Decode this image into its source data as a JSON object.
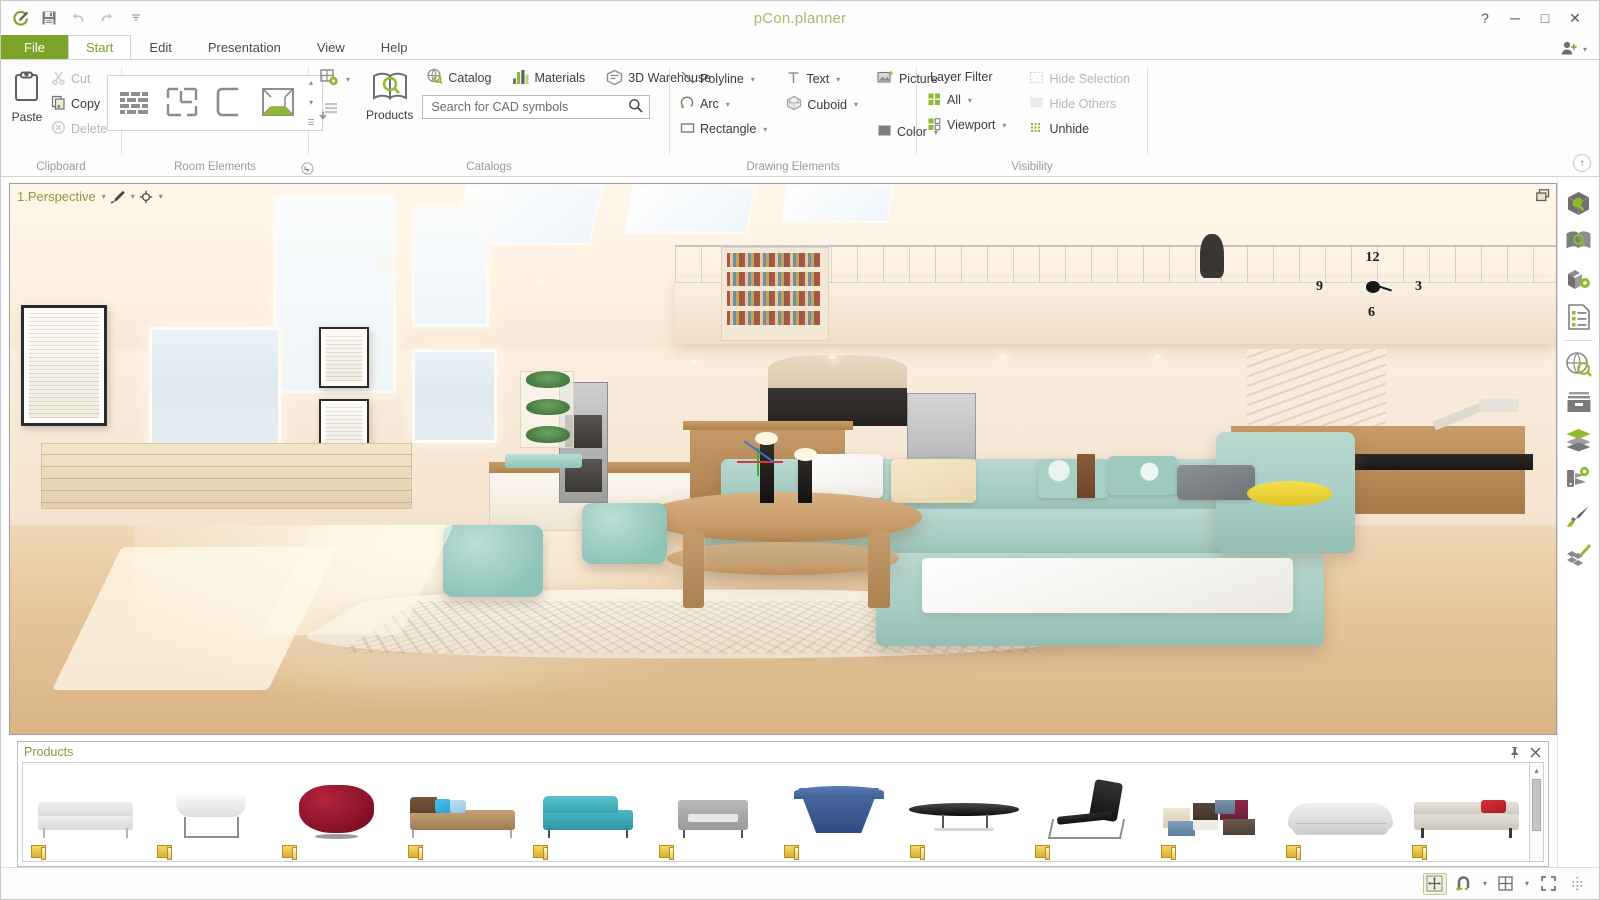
{
  "window": {
    "title": "pCon.planner",
    "help_label": "?",
    "minimize_label": "─",
    "maximize_label": "□",
    "close_label": "✕"
  },
  "quick_access": [
    {
      "name": "app-logo-icon",
      "label": "pCon logo"
    },
    {
      "name": "save-icon",
      "label": "Save"
    },
    {
      "name": "undo-icon",
      "label": "Undo"
    },
    {
      "name": "redo-icon",
      "label": "Redo"
    },
    {
      "name": "customize-qat-icon",
      "label": "Customize Quick Access Toolbar"
    }
  ],
  "tabs": [
    {
      "label": "File",
      "kind": "file"
    },
    {
      "label": "Start",
      "kind": "active"
    },
    {
      "label": "Edit",
      "kind": "normal"
    },
    {
      "label": "Presentation",
      "kind": "normal"
    },
    {
      "label": "View",
      "kind": "normal"
    },
    {
      "label": "Help",
      "kind": "normal"
    }
  ],
  "account": {
    "name": "account-icon",
    "caret": "▾"
  },
  "ribbon": {
    "collapse_label": "↑",
    "groups": {
      "clipboard": {
        "label": "Clipboard",
        "paste": "Paste",
        "cut": "Cut",
        "copy": "Copy",
        "delete": "Delete"
      },
      "room_elements": {
        "label": "Room Elements",
        "items": [
          {
            "name": "wall-tool",
            "label": "Wall"
          },
          {
            "name": "floorplan-tool",
            "label": "Floor Plan"
          },
          {
            "name": "slab-tool",
            "label": "Slab"
          },
          {
            "name": "room-tool",
            "label": "Room"
          }
        ],
        "scroll_up": "▴",
        "scroll_down": "▾",
        "more": "▾"
      },
      "catalogs": {
        "label": "Catalogs",
        "products": "Products",
        "catalog": "Catalog",
        "materials": "Materials",
        "warehouse": "3D Warehouse",
        "search_placeholder": "Search for CAD symbols",
        "search_value": ""
      },
      "drawing_elements": {
        "label": "Drawing Elements",
        "polyline": "Polyline",
        "arc": "Arc",
        "rectangle": "Rectangle",
        "text": "Text",
        "cuboid": "Cuboid",
        "picture": "Picture",
        "color": "Color"
      },
      "visibility": {
        "label": "Visibility",
        "layer_filter": "Layer Filter",
        "all": "All",
        "viewport": "Viewport",
        "hide_selection": "Hide Selection",
        "hide_others": "Hide Others",
        "unhide": "Unhide"
      }
    }
  },
  "viewport": {
    "view_name": "1.Perspective",
    "caret": "▾",
    "render_mode_icon": "pen-render-icon",
    "camera_icon": "camera-target-icon",
    "corner_icon": "restore-viewport-icon",
    "clock": {
      "twelve": "12",
      "three": "3",
      "six": "6",
      "nine": "9"
    }
  },
  "right_sidebar": {
    "items": [
      {
        "name": "object-properties-icon",
        "label": "Object Properties"
      },
      {
        "name": "catalog-browser-icon",
        "label": "Catalog"
      },
      {
        "name": "product-settings-icon",
        "label": "Product Settings"
      },
      {
        "name": "article-list-icon",
        "label": "Article List"
      },
      {
        "name": "online-search-icon",
        "label": "Online Search"
      },
      {
        "name": "archive-icon",
        "label": "Archive"
      },
      {
        "name": "layers-icon",
        "label": "Layers"
      },
      {
        "name": "lighting-icon",
        "label": "Lighting"
      },
      {
        "name": "material-editor-icon",
        "label": "Material Editor"
      },
      {
        "name": "texture-editor-icon",
        "label": "Texture Editor"
      }
    ]
  },
  "products_panel": {
    "title": "Products",
    "pin_icon": "pin-icon",
    "close_icon": "close-icon",
    "scroll_up": "▴",
    "items": [
      {
        "name": "product-sofa-white",
        "label": "White 3-seat sofa"
      },
      {
        "name": "product-chair-shell",
        "label": "White shell chair"
      },
      {
        "name": "product-armchair-red",
        "label": "Red lounge armchair"
      },
      {
        "name": "product-sofa-brown",
        "label": "Brown sofa with blue cushions"
      },
      {
        "name": "product-sofa-teal",
        "label": "Teal 2-seat sofa"
      },
      {
        "name": "product-armchair-grey",
        "label": "Grey armchair"
      },
      {
        "name": "product-armchair-blue",
        "label": "Blue tulip armchair"
      },
      {
        "name": "product-table-black",
        "label": "Black low table"
      },
      {
        "name": "product-lounge-chair-black",
        "label": "Black sled lounge chair"
      },
      {
        "name": "product-modular-seating",
        "label": "Modular seating group"
      },
      {
        "name": "product-sofa-grey-round",
        "label": "Grey rounded sofa"
      },
      {
        "name": "product-sofa-beige",
        "label": "Beige sofa with red pillow"
      }
    ]
  },
  "statusbar": {
    "items": [
      {
        "name": "move-gizmo-button",
        "state": "on"
      },
      {
        "name": "snap-magnet-button",
        "state": "off"
      },
      {
        "name": "grid-button",
        "state": "off"
      },
      {
        "name": "fullscreen-button",
        "state": "off"
      },
      {
        "name": "snap-points-button",
        "state": "off"
      }
    ],
    "caret": "▾"
  }
}
